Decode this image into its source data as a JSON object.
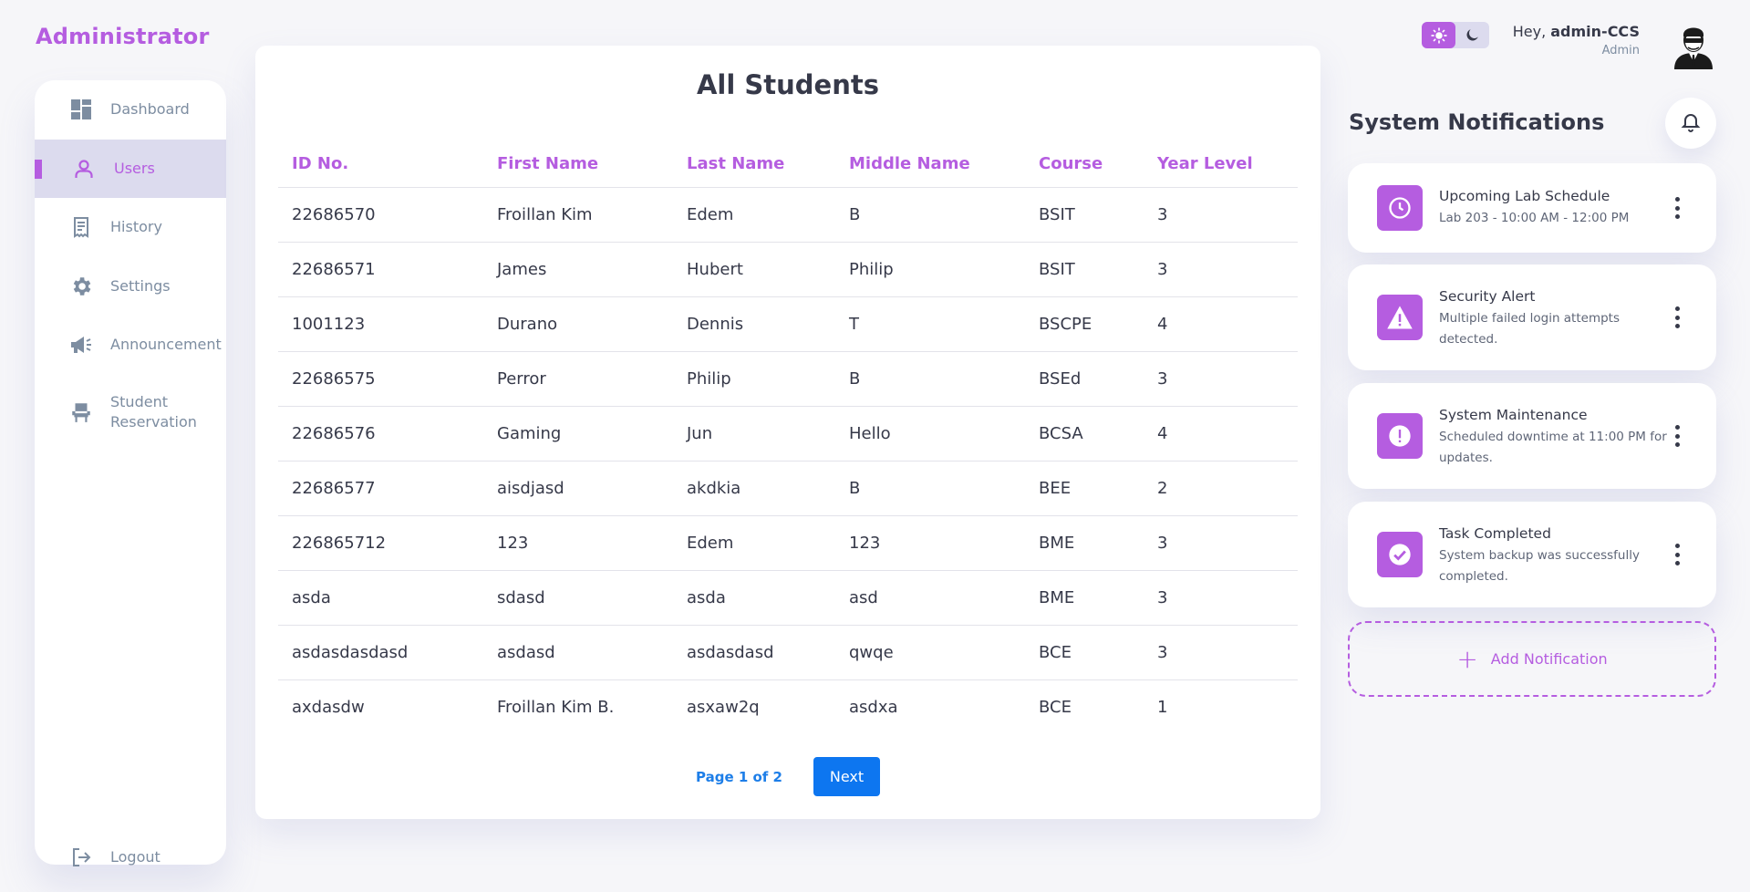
{
  "brand": "Administrator",
  "sidebar": {
    "items": [
      {
        "label": "Dashboard",
        "icon": "dashboard-icon"
      },
      {
        "label": "Users",
        "icon": "user-icon",
        "active": true
      },
      {
        "label": "History",
        "icon": "receipt-icon"
      },
      {
        "label": "Settings",
        "icon": "gear-icon"
      },
      {
        "label": "Announcement",
        "icon": "megaphone-icon"
      },
      {
        "label": "Student Reservation",
        "icon": "chair-icon"
      }
    ],
    "logout": {
      "label": "Logout",
      "icon": "logout-icon"
    }
  },
  "main": {
    "title": "All Students",
    "columns": [
      "ID No.",
      "First Name",
      "Last Name",
      "Middle Name",
      "Course",
      "Year Level"
    ],
    "rows": [
      [
        "22686570",
        "Froillan Kim",
        "Edem",
        "B",
        "BSIT",
        "3"
      ],
      [
        "22686571",
        "James",
        "Hubert",
        "Philip",
        "BSIT",
        "3"
      ],
      [
        "1001123",
        "Durano",
        "Dennis",
        "T",
        "BSCPE",
        "4"
      ],
      [
        "22686575",
        "Perror",
        "Philip",
        "B",
        "BSEd",
        "3"
      ],
      [
        "22686576",
        "Gaming",
        "Jun",
        "Hello",
        "BCSA",
        "4"
      ],
      [
        "22686577",
        "aisdjasd",
        "akdkia",
        "B",
        "BEE",
        "2"
      ],
      [
        "226865712",
        "123",
        "Edem",
        "123",
        "BME",
        "3"
      ],
      [
        "asda",
        "sdasd",
        "asda",
        "asd",
        "BME",
        "3"
      ],
      [
        "asdasdasdasd",
        "asdasd",
        "asdasdasd",
        "qwqe",
        "BCE",
        "3"
      ],
      [
        "axdasdw",
        "Froillan Kim B.",
        "asxaw2q",
        "asdxa",
        "BCE",
        "1"
      ]
    ],
    "pagination": {
      "info": "Page 1 of 2",
      "next_label": "Next"
    }
  },
  "header": {
    "greeting_prefix": "Hey, ",
    "username": "admin-CCS",
    "role": "Admin",
    "theme": {
      "active": "light",
      "icons": [
        "sun-icon",
        "moon-icon"
      ]
    }
  },
  "notifications": {
    "title": "System Notifications",
    "items": [
      {
        "title": "Upcoming Lab Schedule",
        "body": "Lab 203 - 10:00 AM - 12:00 PM",
        "icon": "clock-icon"
      },
      {
        "title": "Security Alert",
        "body": "Multiple failed login attempts detected.",
        "icon": "warning-icon"
      },
      {
        "title": "System Maintenance",
        "body": "Scheduled downtime at 11:00 PM for updates.",
        "icon": "exclamation-icon"
      },
      {
        "title": "Task Completed",
        "body": "System backup was successfully completed.",
        "icon": "check-icon"
      }
    ],
    "add_label": "Add Notification"
  },
  "colors": {
    "accent": "#b55de0",
    "active_bg": "#dcdbee",
    "text": "#363949",
    "muted": "#7d8da1",
    "button_blue": "#0d76f0",
    "background": "#f6f6f9"
  }
}
